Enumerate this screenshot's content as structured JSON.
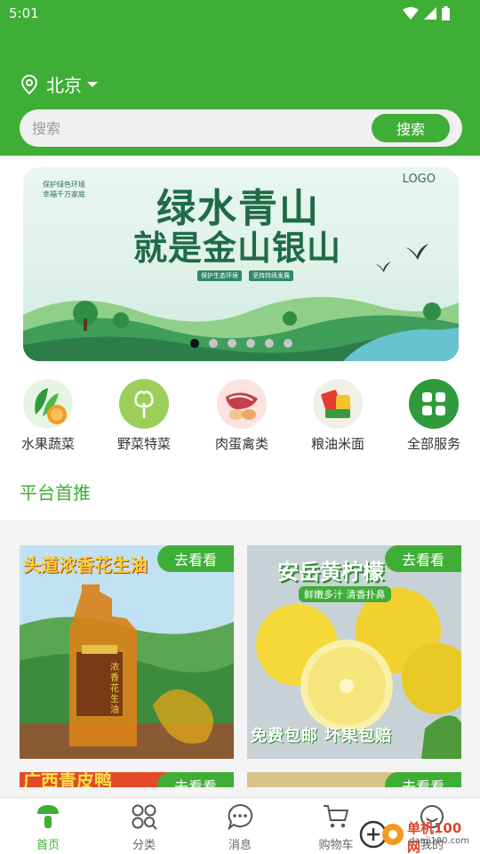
{
  "status_bar": {
    "time": "5:01"
  },
  "location": {
    "city": "北京"
  },
  "search": {
    "placeholder": "搜索",
    "button_label": "搜索"
  },
  "banner": {
    "logo": "LOGO",
    "title_line1": "绿水青山",
    "title_line2": "就是金山银山",
    "small_line1": "保护绿色环境",
    "small_line2": "幸福千万家庭",
    "sub_left": "保护生态环境",
    "sub_right": "坚持持续发展",
    "dot_count": 6,
    "active_dot": 0
  },
  "categories": [
    {
      "label": "水果蔬菜",
      "icon": "fruit-vegetable-icon"
    },
    {
      "label": "野菜特菜",
      "icon": "wild-vegetable-icon"
    },
    {
      "label": "肉蛋禽类",
      "icon": "meat-egg-icon"
    },
    {
      "label": "粮油米面",
      "icon": "grain-oil-icon"
    },
    {
      "label": "全部服务",
      "icon": "all-services-icon"
    }
  ],
  "section": {
    "title": "平台首推"
  },
  "products": [
    {
      "button": "去看看",
      "headline": "头道浓香花生油",
      "bottle_text": "浓香花生油"
    },
    {
      "button": "去看看",
      "headline": "安岳黄柠檬",
      "tagline": "鲜嫩多汁 清香扑鼻",
      "promo": "免费包邮 坏果包赔"
    },
    {
      "button": "去看看",
      "headline": "广西青皮鸭"
    },
    {
      "button": "去看看"
    }
  ],
  "tabbar": [
    {
      "label": "首页",
      "icon": "home-icon",
      "active": true
    },
    {
      "label": "分类",
      "icon": "category-icon",
      "active": false
    },
    {
      "label": "消息",
      "icon": "message-icon",
      "active": false
    },
    {
      "label": "购物车",
      "icon": "cart-icon",
      "active": false
    },
    {
      "label": "我的",
      "icon": "profile-icon",
      "active": false
    }
  ],
  "watermark": {
    "text": "单机100网",
    "url": "danji100.com"
  },
  "colors": {
    "brand": "#3fae37",
    "page_bg": "#f4f4f4"
  }
}
